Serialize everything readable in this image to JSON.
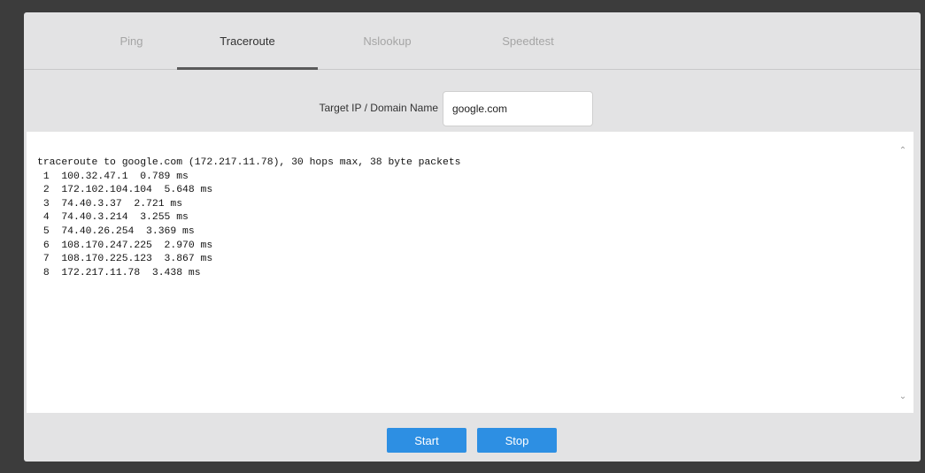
{
  "tabs": [
    {
      "label": "Ping",
      "active": false
    },
    {
      "label": "Traceroute",
      "active": true
    },
    {
      "label": "Nslookup",
      "active": false
    },
    {
      "label": "Speedtest",
      "active": false
    }
  ],
  "target": {
    "label": "Target IP / Domain Name",
    "value": "google.com"
  },
  "output": {
    "lines": [
      "traceroute to google.com (172.217.11.78), 30 hops max, 38 byte packets",
      " 1  100.32.47.1  0.789 ms",
      " 2  172.102.104.104  5.648 ms",
      " 3  74.40.3.37  2.721 ms",
      " 4  74.40.3.214  3.255 ms",
      " 5  74.40.26.254  3.369 ms",
      " 6  108.170.247.225  2.970 ms",
      " 7  108.170.225.123  3.867 ms",
      " 8  172.217.11.78  3.438 ms"
    ]
  },
  "buttons": {
    "start_label": "Start",
    "stop_label": "Stop"
  },
  "icons": {
    "scroll_up": "chevron-up-icon",
    "scroll_down": "chevron-down-icon"
  },
  "colors": {
    "button_blue": "#2d8fe3",
    "panel_bg": "#e3e3e4",
    "backdrop": "#3c3c3c"
  }
}
